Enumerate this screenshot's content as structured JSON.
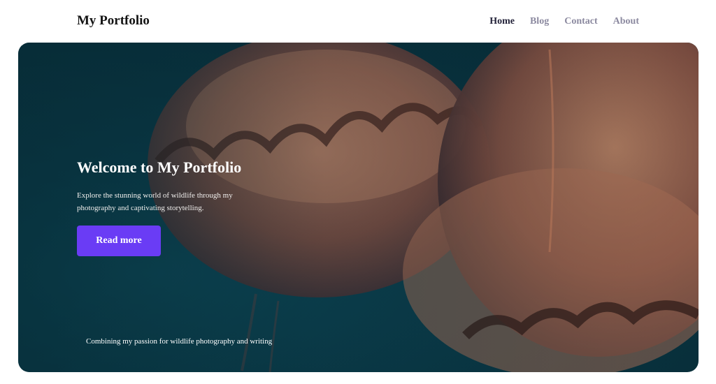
{
  "header": {
    "logo": "My Portfolio",
    "nav": [
      {
        "label": "Home",
        "active": true
      },
      {
        "label": "Blog",
        "active": false
      },
      {
        "label": "Contact",
        "active": false
      },
      {
        "label": "About",
        "active": false
      }
    ]
  },
  "hero": {
    "background_subject": "jellyfish",
    "title": "Welcome to My Portfolio",
    "description": "Explore the stunning world of wildlife through my photography and captivating storytelling.",
    "button_label": "Read more",
    "caption": "Combining my passion for wildlife photography and writing"
  },
  "colors": {
    "accent": "#6a3cf5",
    "nav_active": "#24233a",
    "nav_inactive": "#8c8aa0",
    "hero_bg": "#0a3a48"
  }
}
